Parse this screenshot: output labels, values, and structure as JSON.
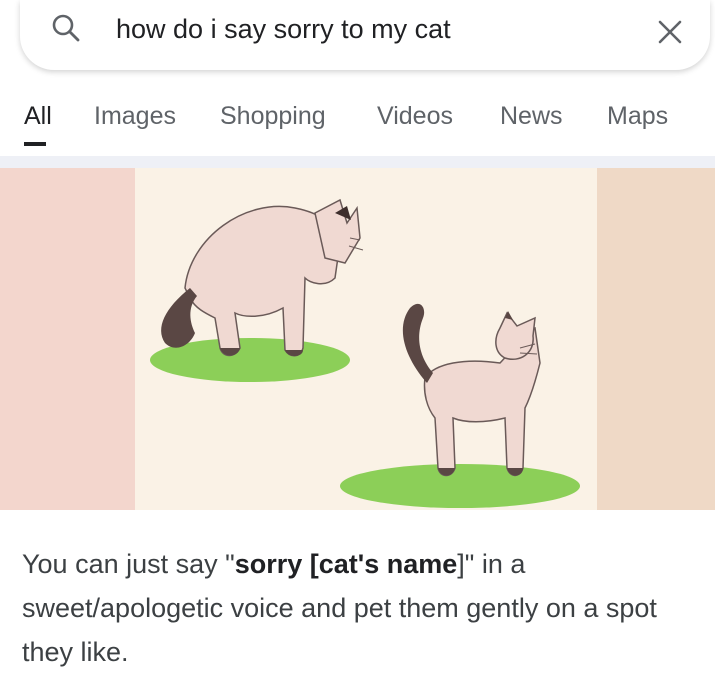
{
  "search": {
    "query": "how do i say sorry to my cat",
    "search_icon": "search-icon",
    "clear_icon": "close-icon"
  },
  "tabs": [
    {
      "label": "All",
      "active": true
    },
    {
      "label": "Images",
      "active": false
    },
    {
      "label": "Shopping",
      "active": false
    },
    {
      "label": "Videos",
      "active": false
    },
    {
      "label": "News",
      "active": false
    },
    {
      "label": "Maps",
      "active": false
    }
  ],
  "result": {
    "image_panel_colors": {
      "left": "#f3d6cd",
      "main": "#faf2e6",
      "right": "#efd9c6"
    },
    "snippet": {
      "pre": "You can just say \"",
      "bold1": "sorry [cat's name",
      "mid": "]\" in a sweet/apologetic voice and pet them gently on a spot they like."
    }
  },
  "colors": {
    "text": "#202124",
    "muted": "#5f6368",
    "divider": "#eef0f6"
  }
}
